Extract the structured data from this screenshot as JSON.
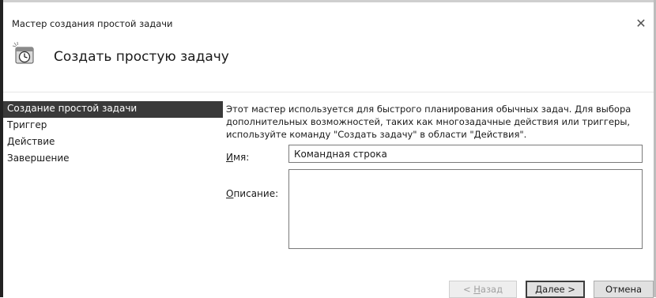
{
  "window": {
    "title": "Мастер создания простой задачи",
    "close_glyph": "✕"
  },
  "header": {
    "icon": "task-scheduler-clock-icon",
    "title": "Создать простую задачу"
  },
  "steps": [
    {
      "label": "Создание простой задачи",
      "active": true
    },
    {
      "label": "Триггер",
      "active": false
    },
    {
      "label": "Действие",
      "active": false
    },
    {
      "label": "Завершение",
      "active": false
    }
  ],
  "main": {
    "description": "Этот мастер используется для быстрого планирования обычных задач.  Для выбора дополнительных возможностей, таких как многозадачные действия или триггеры, используйте команду \"Создать задачу\" в области \"Действия\".",
    "name_label_accel": "И",
    "name_label_rest": "мя:",
    "name_value": "Командная строка",
    "desc_label_accel": "О",
    "desc_label_rest": "писание:",
    "desc_value": ""
  },
  "buttons": {
    "back_accel": "Н",
    "back_prefix": "< ",
    "back_rest": "азад",
    "next_accel": "Д",
    "next_rest": "алее >",
    "cancel": "Отмена"
  },
  "colors": {
    "active_step_bg": "#3a3a3a",
    "active_step_fg": "#ffffff",
    "button_bg": "#e1e1e1",
    "disabled_text": "#a0a0a0"
  }
}
